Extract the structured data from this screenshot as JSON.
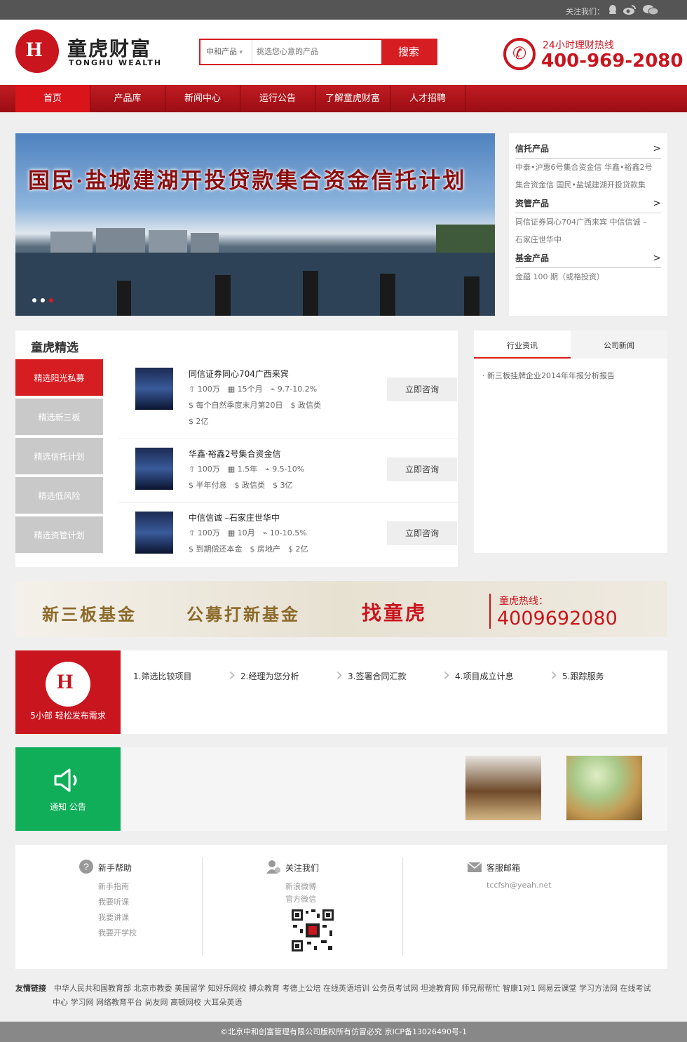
{
  "topbar": {
    "follow_label": "关注我们："
  },
  "header": {
    "logo_cn": "童虎财富",
    "logo_en": "TONGHU WEALTH",
    "search_category": "中和产品",
    "search_placeholder": "挑选您心意的产品",
    "search_button": "搜索",
    "hotline_label": "24小时理财热线",
    "hotline_number": "400-969-2080"
  },
  "nav": {
    "items": [
      "首页",
      "产品库",
      "新闻中心",
      "运行公告",
      "了解童虎财富",
      "人才招聘"
    ]
  },
  "banner": {
    "title": "国民·盐城建湖开投贷款集合资金信托计划"
  },
  "categories": [
    {
      "title": "信托产品",
      "arrow": ">",
      "lines": [
        "中泰•沪惠6号集合资金信  华鑫•裕鑫2号",
        "集合资金信  国民•盐城建湖开投贷款集"
      ]
    },
    {
      "title": "资管产品",
      "arrow": ">",
      "lines": [
        "同信证券同心704广西来宾  中信信诚 –",
        "石家庄世华中"
      ]
    },
    {
      "title": "基金产品",
      "arrow": ">",
      "lines": [
        "金蕴 100 期（或格投资）"
      ]
    }
  ],
  "selection": {
    "title": "童虎精选",
    "tabs": [
      "精选阳光私募",
      "精选新三板",
      "精选信托计划",
      "精选低风险",
      "精选资管计划"
    ],
    "products": [
      {
        "name": "同信证券同心704广西来宾",
        "amount": "100万",
        "term": "15个月",
        "rate": "9.7-10.2%",
        "pay": "每个自然季度末月第20日",
        "type": "政信类",
        "scale": "2亿",
        "button": "立即咨询"
      },
      {
        "name": "华鑫·裕鑫2号集合资金信",
        "amount": "100万",
        "term": "1.5年",
        "rate": "9.5-10%",
        "pay": "半年付息",
        "type": "政信类",
        "scale": "3亿",
        "button": "立即咨询"
      },
      {
        "name": "中信信诚 –石家庄世华中",
        "amount": "100万",
        "term": "10月",
        "rate": "10-10.5%",
        "pay": "到期偿还本金",
        "type": "房地产",
        "scale": "2亿",
        "button": "立即咨询"
      }
    ]
  },
  "news": {
    "tabs": [
      "行业资讯",
      "公司新闻"
    ],
    "items": [
      "新三板挂牌企业2014年年报分析报告"
    ]
  },
  "ad": {
    "text1": "新三板基金",
    "text2": "公募打新基金",
    "text3": "找童虎",
    "hotline_label": "童虎热线：",
    "hotline_number": "4009692080"
  },
  "steps": {
    "badge_text": "5小部 轻松发布需求",
    "items": [
      "1.筛选比较项目",
      "2.经理为您分析",
      "3.签署合同汇款",
      "4.项目成立计息",
      "5.跟踪服务"
    ]
  },
  "notice": {
    "label": "通知 公告"
  },
  "footer": {
    "help": {
      "title": "新手帮助",
      "items": [
        "新手指南",
        "我要听课",
        "我要讲课",
        "我要开学校"
      ]
    },
    "follow": {
      "title": "关注我们",
      "items": [
        "新浪微博",
        "官方微信"
      ]
    },
    "mail": {
      "title": "客服邮箱",
      "address": "tccfsh@yeah.net"
    }
  },
  "links": {
    "label": "友情链接",
    "line1": "中华人民共和国教育部 北京市教委 美国留学 知好乐网校 搏众教育 考德上公培 在线英语培训 公务员考试网 坦途教育网 师兄帮帮忙 智康1对1 网易云课堂 学习方法网 在线考试",
    "line2": "中心 学习网 网络教育平台 尚友网 高顿网校 大耳朵英语"
  },
  "copyright": "©北京中和创富管理有限公司版权所有仿冒必究 京ICP备13026490号-1",
  "colors": {
    "brand": "#c9151e",
    "notice": "#11ae5a"
  }
}
